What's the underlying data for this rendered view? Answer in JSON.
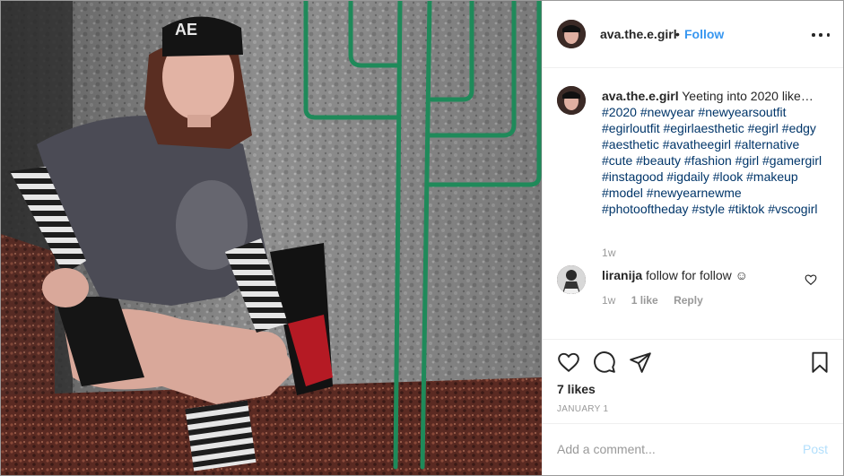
{
  "post": {
    "username": "ava.the.e.girl",
    "dot": "•",
    "follow_label": "Follow",
    "caption_text": " Yeeting into 2020 like…",
    "caption_tags": "#2020 #newyear #newyearsoutfit #egirloutfit #egirlaesthetic #egirl #edgy #aesthetic #avatheegirl #alternative #cute #beauty #fashion #girl #gamergirl #instagood #igdaily #look #makeup #model #newyearnewme #photooftheday #style #tiktok #vscogirl",
    "caption_time": "1w",
    "likes": "7 likes",
    "date": "JANUARY 1"
  },
  "comment": {
    "username": "liranija",
    "text": " follow for follow ☺",
    "time": "1w",
    "likes": "1 like",
    "reply": "Reply"
  },
  "composer": {
    "placeholder": "Add a comment...",
    "post_label": "Post"
  },
  "icons": {
    "more": "more-options-icon",
    "like": "heart-icon",
    "comment": "comment-icon",
    "share": "paper-plane-icon",
    "save": "bookmark-icon"
  },
  "colors": {
    "link_blue": "#3897f0",
    "hashtag": "#003569",
    "muted": "#999999",
    "post_disabled": "#b2dffc"
  },
  "photo": {
    "beanie_text": "AE"
  }
}
